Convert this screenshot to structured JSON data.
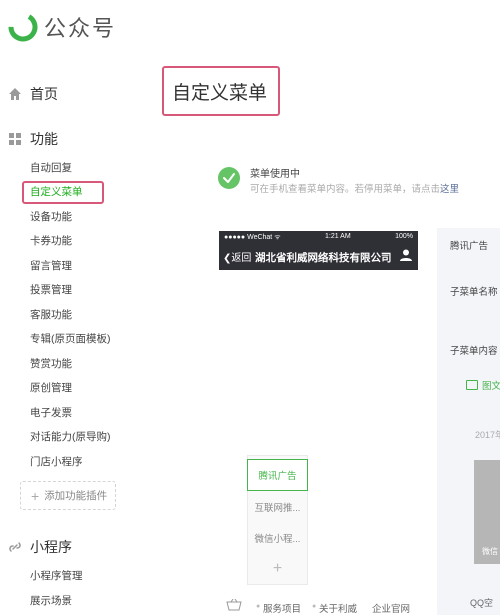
{
  "brand": {
    "name": "公众号"
  },
  "nav": {
    "home": {
      "label": "首页",
      "icon": "home-icon"
    },
    "features": {
      "label": "功能",
      "icon": "grid-icon"
    },
    "items": [
      {
        "label": "自动回复"
      },
      {
        "label": "自定义菜单",
        "active": true
      },
      {
        "label": "设备功能"
      },
      {
        "label": "卡券功能"
      },
      {
        "label": "留言管理"
      },
      {
        "label": "投票管理"
      },
      {
        "label": "客服功能"
      },
      {
        "label": "专辑(原页面模板)"
      },
      {
        "label": "赞赏功能"
      },
      {
        "label": "原创管理"
      },
      {
        "label": "电子发票"
      },
      {
        "label": "对话能力(原导购)"
      },
      {
        "label": "门店小程序"
      }
    ],
    "add_plugin": "添加功能插件",
    "mini_program": {
      "label": "小程序",
      "icon": "link-icon"
    },
    "mini_items": [
      {
        "label": "小程序管理"
      },
      {
        "label": "展示场景"
      }
    ]
  },
  "main": {
    "title": "自定义菜单",
    "status": {
      "title": "菜单使用中",
      "desc": "可在手机查看菜单内容。若停用菜单，请点击",
      "link": "这里"
    },
    "phone": {
      "status_left": "●●●●● WeChat ᯤ",
      "status_time": "1:21 AM",
      "status_right": "100%",
      "back": "返回",
      "title": "湖北省利威网络科技有限公司"
    },
    "menu": {
      "items": [
        "腾讯广告",
        "互联网推...",
        "微信小程..."
      ],
      "add": "+"
    },
    "editor": {
      "name": "腾讯广告",
      "sub_name_label": "子菜单名称",
      "sub_content_label": "子菜单内容",
      "img_text": "图文",
      "date": "2017年",
      "card_text": "微信"
    }
  },
  "footer": {
    "links": [
      "服务项目",
      "关于利威",
      "企业官网"
    ],
    "qq": "QQ空"
  },
  "colors": {
    "accent": "#44b549",
    "highlight": "#d8587a",
    "link": "#576b95"
  }
}
